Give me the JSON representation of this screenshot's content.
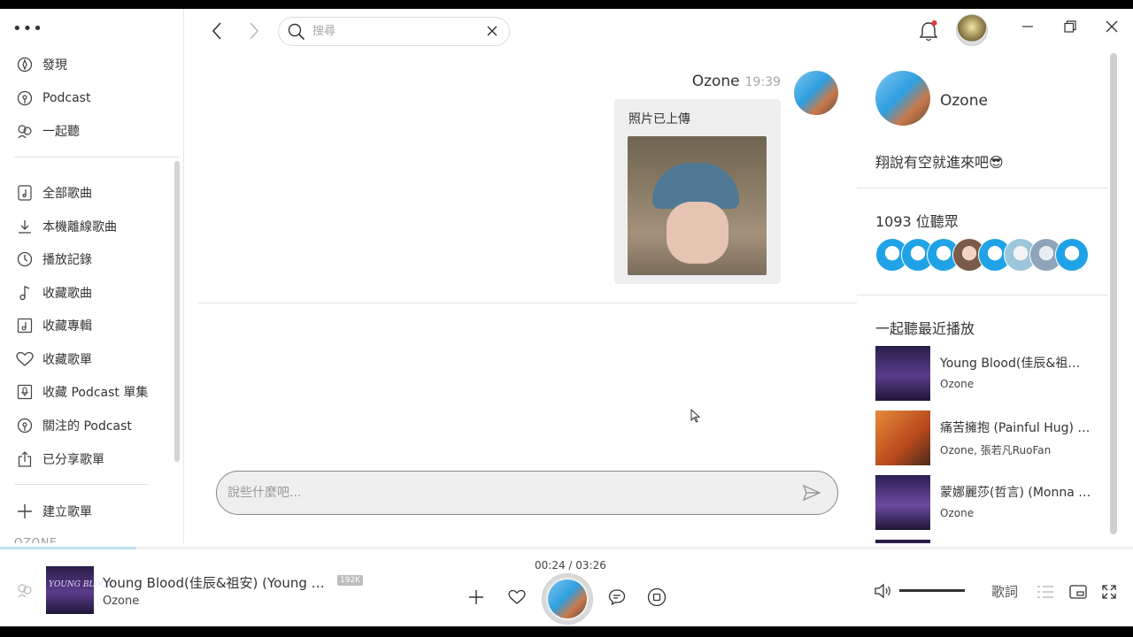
{
  "sidebar": {
    "top_items": [
      {
        "label": "發現",
        "icon": "discover-icon"
      },
      {
        "label": "Podcast",
        "icon": "podcast-icon"
      },
      {
        "label": "一起聽",
        "icon": "listen-together-icon"
      }
    ],
    "library_items": [
      {
        "label": "全部歌曲",
        "icon": "all-songs-icon"
      },
      {
        "label": "本機離線歌曲",
        "icon": "download-icon"
      },
      {
        "label": "播放記錄",
        "icon": "history-icon"
      },
      {
        "label": "收藏歌曲",
        "icon": "music-note-icon"
      },
      {
        "label": "收藏專輯",
        "icon": "album-icon"
      },
      {
        "label": "收藏歌單",
        "icon": "heart-icon"
      },
      {
        "label": "收藏 Podcast 單集",
        "icon": "microphone-icon"
      },
      {
        "label": "關注的 Podcast",
        "icon": "podcast-icon"
      },
      {
        "label": "已分享歌單",
        "icon": "share-icon"
      }
    ],
    "create_playlist": "建立歌單",
    "truncated_label": "OZONE"
  },
  "search": {
    "placeholder": "搜尋"
  },
  "chat": {
    "sender": "Ozone",
    "time": "19:39",
    "message_text": "照片已上傳",
    "input_placeholder": "說些什麼吧..."
  },
  "room": {
    "name": "Ozone",
    "description": "翔說有空就進來吧😎",
    "listeners_heading": "1093 位聽眾",
    "recent_heading": "一起聽最近播放",
    "recent": [
      {
        "title": "Young Blood(佳辰&祖安) (Young Blood)",
        "artist": "Ozone",
        "cover_color": "#3a2a5e"
      },
      {
        "title": "痛苦擁抱 (Painful Hug) (feat. 張若凡RuoFan)",
        "artist": "Ozone, 張若凡RuoFan",
        "cover_color": "#d86a2a"
      },
      {
        "title": "蒙娜麗莎(哲言) (Monna Lisa)",
        "artist": "Ozone",
        "cover_color": "#3e2b6a"
      }
    ]
  },
  "player": {
    "title": "Young Blood(佳辰&祖安) (Young Blood)",
    "quality": "192K",
    "artist": "Ozone",
    "time": "00:24 / 03:26",
    "progress": 0.12,
    "volume": 1.0,
    "lyrics_label": "歌詞",
    "cover_text": "YOUNG BLOOD"
  },
  "colors": {
    "accent": "#2ea6e0",
    "notification": "#e53935"
  }
}
